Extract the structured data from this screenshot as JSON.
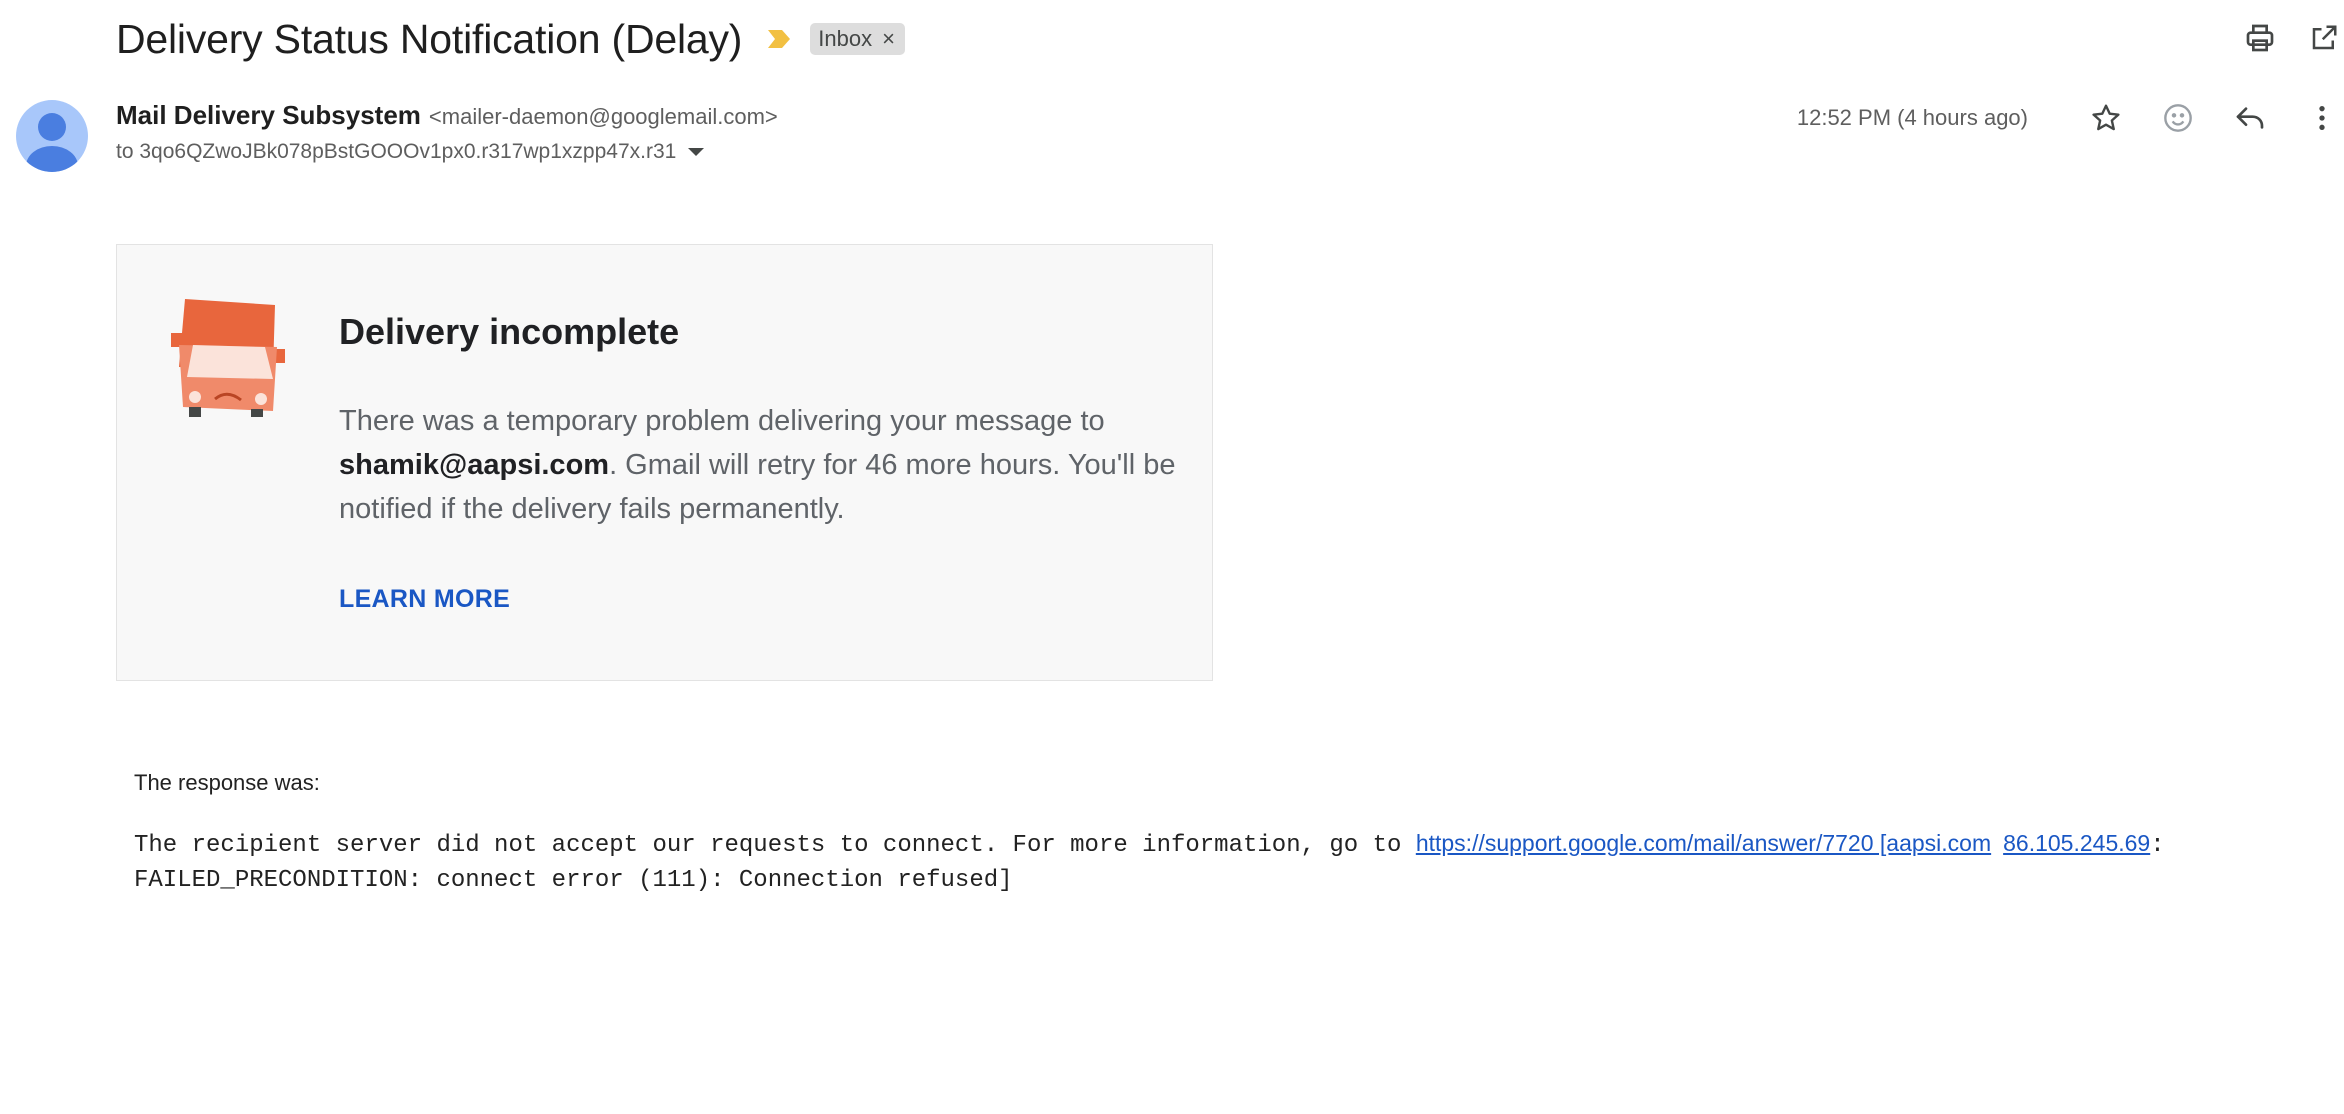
{
  "email": {
    "subject": "Delivery Status Notification (Delay)",
    "label": "Inbox",
    "label_remove": "×",
    "sender_name": "Mail Delivery Subsystem",
    "sender_email": "<mailer-daemon@googlemail.com>",
    "to_line": "to 3qo6QZwoJBk078pBstGOOOv1px0.r317wp1xzpp47x.r31",
    "timestamp": "12:52 PM (4 hours ago)"
  },
  "icons": {
    "top": [
      "print-icon",
      "open-in-new-window-icon"
    ],
    "meta": [
      "star-icon",
      "emoji-reaction-icon",
      "reply-icon",
      "more-vertical-icon"
    ]
  },
  "card": {
    "title": "Delivery incomplete",
    "body_pre": "There was a temporary problem delivering your message to ",
    "recipient": "shamik@aapsi.com",
    "body_post": ". Gmail will retry for 46 more hours. You'll be notified if the delivery fails permanently.",
    "learn_more": "LEARN MORE"
  },
  "response": {
    "label": "The response was:",
    "text_pre": "The recipient server did not accept our requests to connect. For more information, go to ",
    "link1": "https://support.google.com/mail/answer/7720 [aapsi.com",
    "link2": "86.105.245.69",
    "text_post": ": FAILED_PRECONDITION: connect error (111): Connection refused]"
  },
  "colors": {
    "accent_blue": "#1a57c4",
    "importance_marker": "#f2c042",
    "truck_orange": "#e8663d",
    "avatar_bg": "#a8c7fa"
  }
}
